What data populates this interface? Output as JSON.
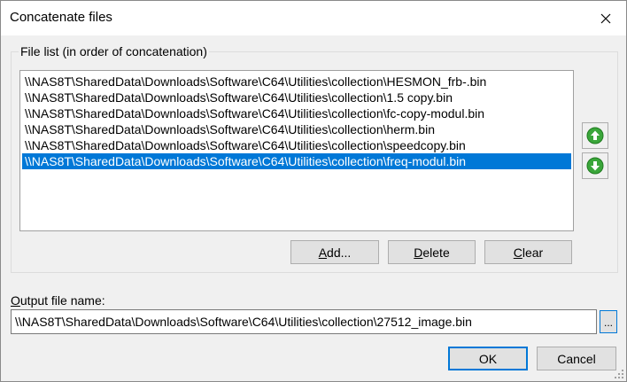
{
  "window": {
    "title": "Concatenate files"
  },
  "file_list": {
    "group_label": "File list (in order of concatenation)",
    "items": [
      "\\\\NAS8T\\SharedData\\Downloads\\Software\\C64\\Utilities\\collection\\HESMON_frb-.bin",
      "\\\\NAS8T\\SharedData\\Downloads\\Software\\C64\\Utilities\\collection\\1.5 copy.bin",
      "\\\\NAS8T\\SharedData\\Downloads\\Software\\C64\\Utilities\\collection\\fc-copy-modul.bin",
      "\\\\NAS8T\\SharedData\\Downloads\\Software\\C64\\Utilities\\collection\\herm.bin",
      "\\\\NAS8T\\SharedData\\Downloads\\Software\\C64\\Utilities\\collection\\speedcopy.bin",
      "\\\\NAS8T\\SharedData\\Downloads\\Software\\C64\\Utilities\\collection\\freq-modul.bin"
    ],
    "selected_index": 5,
    "move_up_icon": "green-arrow-up-icon",
    "move_down_icon": "green-arrow-down-icon"
  },
  "buttons": {
    "add": "Add...",
    "delete": "Delete",
    "clear": "Clear",
    "ok": "OK",
    "cancel": "Cancel",
    "browse": "..."
  },
  "output": {
    "label": "Output file name:",
    "value": "\\\\NAS8T\\SharedData\\Downloads\\Software\\C64\\Utilities\\collection\\27512_image.bin"
  },
  "colors": {
    "selection": "#0078d7",
    "arrow_green": "#3aa63a"
  }
}
